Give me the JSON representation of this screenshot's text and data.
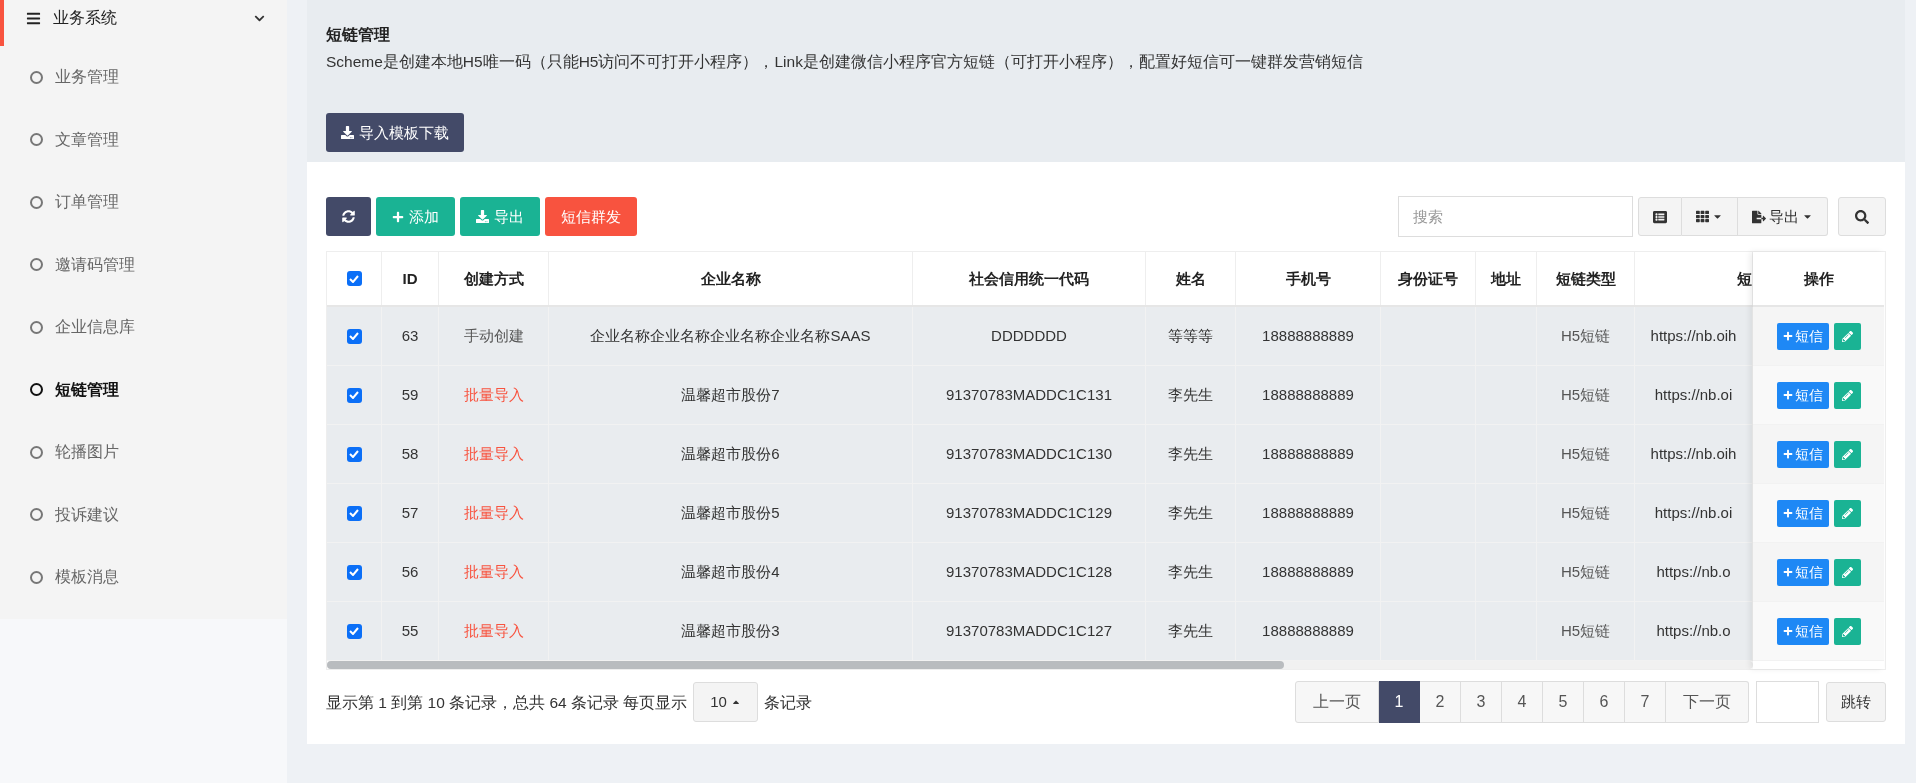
{
  "sidebar": {
    "group": {
      "label": "业务系统",
      "expanded": true
    },
    "items": [
      {
        "label": "业务管理",
        "selected": false
      },
      {
        "label": "文章管理",
        "selected": false
      },
      {
        "label": "订单管理",
        "selected": false
      },
      {
        "label": "邀请码管理",
        "selected": false
      },
      {
        "label": "企业信息库",
        "selected": false
      },
      {
        "label": "短链管理",
        "selected": true
      },
      {
        "label": "轮播图片",
        "selected": false
      },
      {
        "label": "投诉建议",
        "selected": false
      },
      {
        "label": "模板消息",
        "selected": false
      }
    ]
  },
  "header": {
    "title": "短链管理",
    "description": "Scheme是创建本地H5唯一码（只能H5访问不可打开小程序），Link是创建微信小程序官方短链（可打开小程序），配置好短信可一键群发营销短信",
    "import_button": "导入模板下载"
  },
  "toolbar": {
    "buttons": [
      {
        "kind": "refresh"
      },
      {
        "kind": "add",
        "label": "添加"
      },
      {
        "kind": "export",
        "label": "导出"
      },
      {
        "kind": "sms",
        "label": "短信群发"
      }
    ],
    "search": {
      "placeholder": "搜索"
    },
    "tools": [
      {
        "kind": "toggle-view"
      },
      {
        "kind": "columns"
      },
      {
        "kind": "export",
        "label": "导出"
      },
      {
        "kind": "search"
      }
    ]
  },
  "table": {
    "all_checked": true,
    "columns": [
      "ID",
      "创建方式",
      "企业名称",
      "社会信用统一代码",
      "姓名",
      "手机号",
      "身份证号",
      "地址",
      "短链类型",
      "短",
      "操作"
    ],
    "rows": [
      {
        "checked": true,
        "id": "63",
        "method": {
          "text": "手动创建",
          "color": "#555555"
        },
        "company": "企业名称企业名称企业名称企业名称SAAS",
        "code": "DDDDDDD",
        "name": "等等等",
        "phone": "18888888889",
        "link_type": "H5短链",
        "link": "https://nb.oih",
        "sms": "短信"
      },
      {
        "checked": true,
        "id": "59",
        "method": {
          "text": "批量导入",
          "color": "#f8533f"
        },
        "company": "温馨超市股份7",
        "code": "91370783MADDC1C131",
        "name": "李先生",
        "phone": "18888888889",
        "link_type": "H5短链",
        "link": "https://nb.oi",
        "sms": "短信"
      },
      {
        "checked": true,
        "id": "58",
        "method": {
          "text": "批量导入",
          "color": "#f8533f"
        },
        "company": "温馨超市股份6",
        "code": "91370783MADDC1C130",
        "name": "李先生",
        "phone": "18888888889",
        "link_type": "H5短链",
        "link": "https://nb.oih",
        "sms": "短信"
      },
      {
        "checked": true,
        "id": "57",
        "method": {
          "text": "批量导入",
          "color": "#f8533f"
        },
        "company": "温馨超市股份5",
        "code": "91370783MADDC1C129",
        "name": "李先生",
        "phone": "18888888889",
        "link_type": "H5短链",
        "link": "https://nb.oi",
        "sms": "短信"
      },
      {
        "checked": true,
        "id": "56",
        "method": {
          "text": "批量导入",
          "color": "#f8533f"
        },
        "company": "温馨超市股份4",
        "code": "91370783MADDC1C128",
        "name": "李先生",
        "phone": "18888888889",
        "link_type": "H5短链",
        "link": "https://nb.o",
        "sms": "短信"
      },
      {
        "checked": true,
        "id": "55",
        "method": {
          "text": "批量导入",
          "color": "#f8533f"
        },
        "company": "温馨超市股份3",
        "code": "91370783MADDC1C127",
        "name": "李先生",
        "phone": "18888888889",
        "link_type": "H5短链",
        "link": "https://nb.o",
        "sms": "短信"
      }
    ]
  },
  "pagination": {
    "summary": "显示第 1 到第 10 条记录，总共 64 条记录 每页显示",
    "page_size": "10",
    "suffix": "条记录",
    "prev": "上一页",
    "pages": [
      {
        "label": "1",
        "selected": true
      },
      {
        "label": "2",
        "selected": false
      },
      {
        "label": "3",
        "selected": false
      },
      {
        "label": "4",
        "selected": false
      },
      {
        "label": "5",
        "selected": false
      },
      {
        "label": "6",
        "selected": false
      },
      {
        "label": "7",
        "selected": false
      }
    ],
    "next": "下一页",
    "jump": "跳转"
  }
}
